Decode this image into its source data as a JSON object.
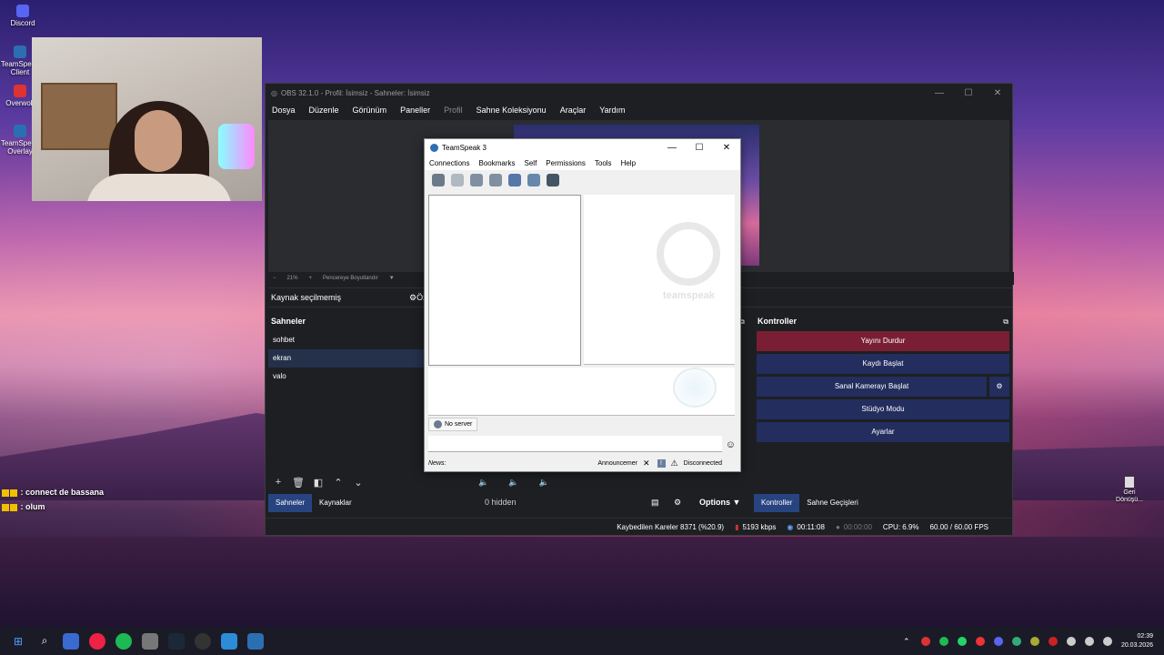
{
  "desktop": {
    "icons": [
      {
        "name": "discord-icon",
        "label": "Discord"
      },
      {
        "name": "teamspeak-client-icon",
        "label": "TeamSpeak Client"
      },
      {
        "name": "overwolf-icon",
        "label": "Overwolf"
      },
      {
        "name": "teamspeak-overlay-icon",
        "label": "TeamSpeak Overlay"
      }
    ],
    "right_icon": {
      "label": "Geri Dönüşü..."
    }
  },
  "chat_overlay": [
    {
      "user": "",
      "message": ": connect de bassana"
    },
    {
      "user": "",
      "message": ": olum"
    }
  ],
  "obs": {
    "title": "OBS 32.1.0 - Profil: İsimsiz - Sahneler: İsimsiz",
    "menu": [
      "Dosya",
      "Düzenle",
      "Görünüm",
      "Paneller",
      "Profil",
      "Sahne Koleksiyonu",
      "Araçlar",
      "Yardım"
    ],
    "zoom": {
      "minus": "−",
      "level": "21%",
      "plus": "+",
      "fit": "Pencereye Boyutlandır"
    },
    "source_bar": {
      "label": "Kaynak seçilmemiş",
      "filters": "Öz"
    },
    "scenes_header": "Sahneler",
    "scenes": [
      "sohbet",
      "ekran",
      "valo"
    ],
    "selected_scene": "ekran",
    "scene_tabs": [
      "Sahneler",
      "Kaynaklar"
    ],
    "mixer": {
      "hidden": "0 hidden",
      "options": "Options"
    },
    "controls_header": "Kontroller",
    "controls": {
      "stop_stream": "Yayını Durdur",
      "start_record": "Kaydı Başlat",
      "virtual_cam": "Sanal Kamerayı Başlat",
      "studio_mode": "Stüdyo Modu",
      "settings": "Ayarlar"
    },
    "control_tabs": [
      "Kontroller",
      "Sahne Geçişleri"
    ],
    "status": {
      "dropped": "Kaybedilen Kareler 8371 (%20.9)",
      "bitrate": "5193 kbps",
      "stream_time": "00:11:08",
      "record_time": "00:00:00",
      "cpu": "CPU: 6.9%",
      "fps": "60.00 / 60.00 FPS"
    }
  },
  "teamspeak": {
    "title": "TeamSpeak 3",
    "menu": [
      "Connections",
      "Bookmarks",
      "Self",
      "Permissions",
      "Tools",
      "Help"
    ],
    "watermark": "teamspeak",
    "server_tab": "No server",
    "news_label": "News:",
    "announcer": "Announcemer",
    "connection_status": "Disconnected"
  },
  "taskbar": {
    "time": "02:39",
    "date": "20.03.2026"
  },
  "colors": {
    "obs_bg": "#1d1f23",
    "stop_button": "#7a1f33",
    "control_button": "#232d5e",
    "active_tab": "#284480"
  }
}
